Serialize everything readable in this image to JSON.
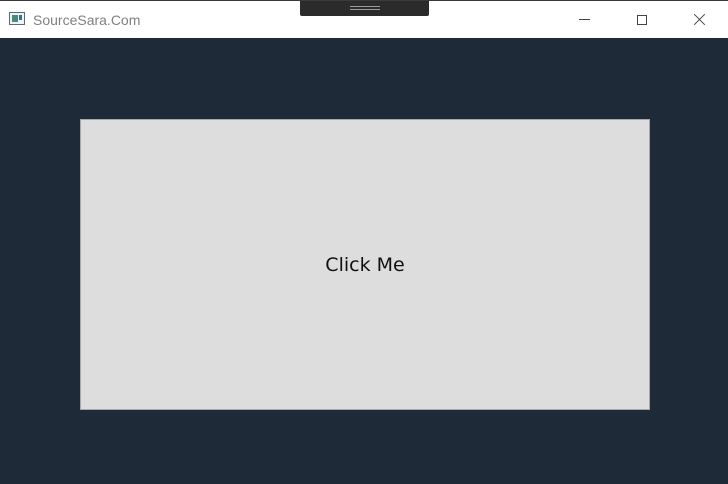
{
  "window": {
    "title": "SourceSara.Com",
    "background_color": "#1f2a38",
    "app_icon": "window-app-icon",
    "controls": {
      "minimize_icon": "minimize-icon",
      "maximize_icon": "maximize-icon",
      "close_icon": "close-icon"
    }
  },
  "content": {
    "button_label": "Click Me",
    "button_color": "#dddddd"
  }
}
